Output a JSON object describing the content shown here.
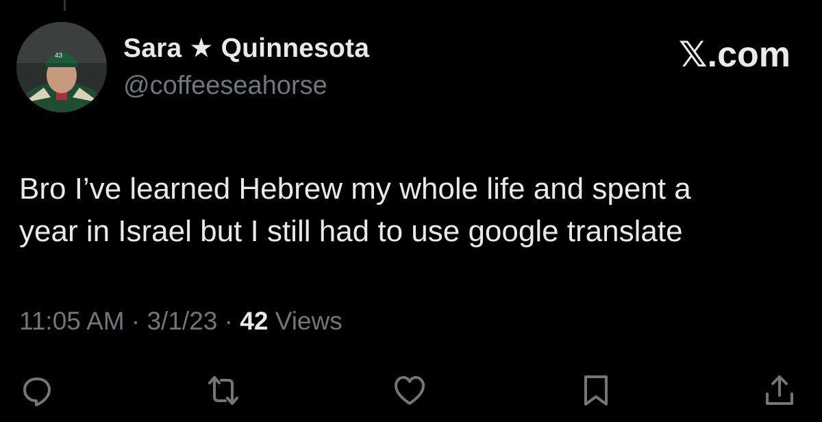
{
  "user": {
    "display_name": "Sara ★ Quinnesota",
    "handle": "@coffeeseahorse",
    "avatar_icon": "profile-avatar"
  },
  "site": {
    "label": "𝕏.com"
  },
  "tweet": {
    "line1": "Bro I’ve learned Hebrew my whole life and spent a",
    "line2": "year in Israel but I still had to use google translate"
  },
  "meta": {
    "time": "11:05 AM",
    "separator": "·",
    "date": "3/1/23",
    "views_count": "42",
    "views_label": "Views"
  },
  "actions": [
    {
      "icon": "reply-icon"
    },
    {
      "icon": "retweet-icon"
    },
    {
      "icon": "like-icon"
    },
    {
      "icon": "bookmark-icon"
    },
    {
      "icon": "share-icon"
    }
  ],
  "colors": {
    "background": "#000000",
    "primary_text": "#e7e9ea",
    "secondary_text": "#71767b",
    "icon": "#71767b"
  }
}
